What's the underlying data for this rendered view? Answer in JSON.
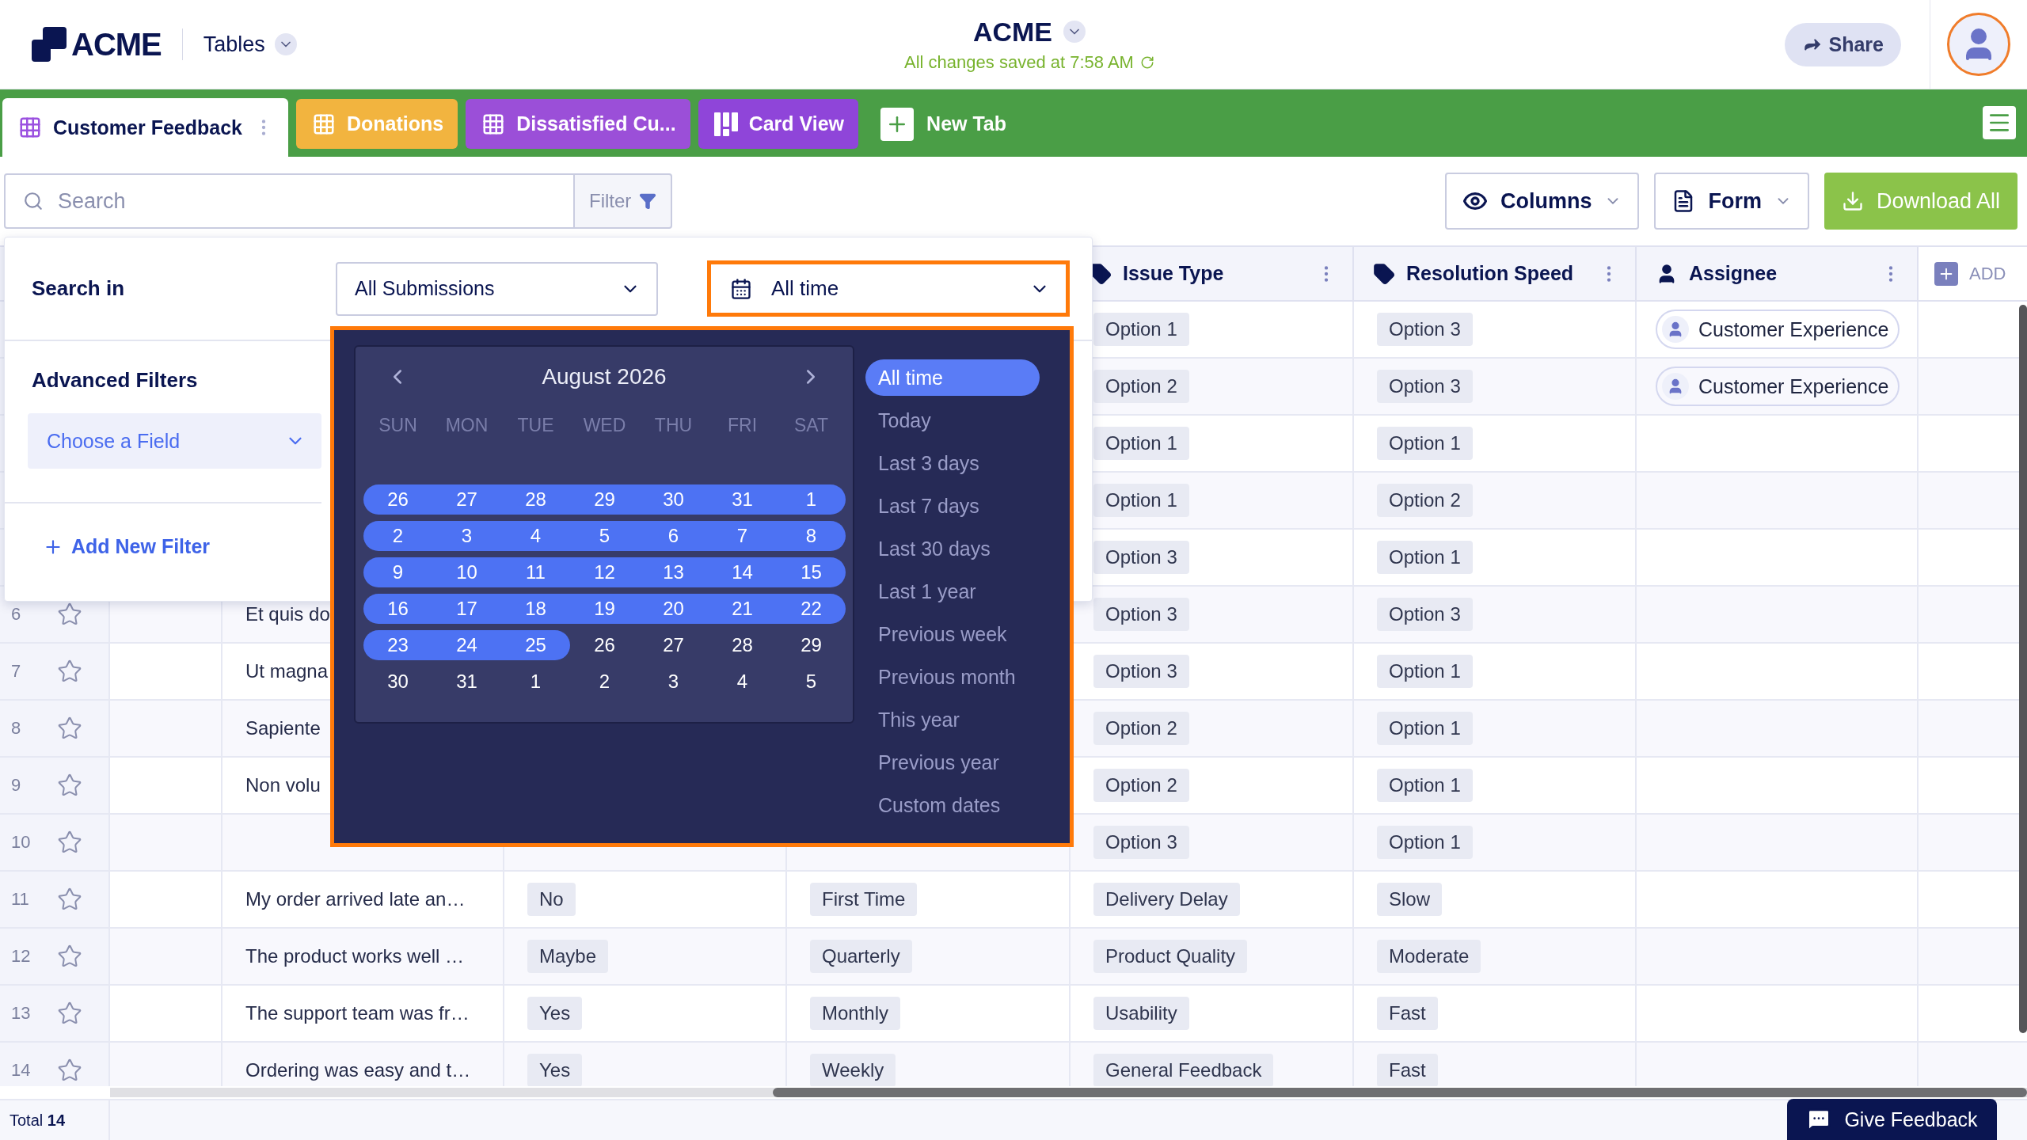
{
  "header": {
    "logo": "ACME",
    "section": "Tables",
    "title": "ACME",
    "saved_status": "All changes saved at 7:58 AM",
    "share": "Share"
  },
  "tabs": [
    {
      "label": "Customer Feedback",
      "kind": "table",
      "selected": true,
      "color": "#9b51e0"
    },
    {
      "label": "Donations",
      "kind": "table",
      "selected": false,
      "color": "#f2b43f"
    },
    {
      "label": "Dissatisfied Cu...",
      "kind": "table",
      "selected": false,
      "color": "#9b4fd8"
    },
    {
      "label": "Card View",
      "kind": "cards",
      "selected": false,
      "color": "#8f45d9"
    }
  ],
  "new_tab": "New Tab",
  "toolbar": {
    "search_placeholder": "Search",
    "filter": "Filter",
    "columns": "Columns",
    "form": "Form",
    "download": "Download All"
  },
  "table": {
    "columns": [
      {
        "label": "Issue Type",
        "kind": "tag"
      },
      {
        "label": "Resolution Speed",
        "kind": "tag"
      },
      {
        "label": "Assignee",
        "kind": "person"
      }
    ],
    "add_column": "ADD",
    "rows": [
      {
        "issue_type": "Option 1",
        "resolution_speed": "Option 3",
        "assignee": "Customer Experience"
      },
      {
        "issue_type": "Option 2",
        "resolution_speed": "Option 3",
        "assignee": "Customer Experience"
      },
      {
        "issue_type": "Option 1",
        "resolution_speed": "Option 1"
      },
      {
        "issue_type": "Option 1",
        "resolution_speed": "Option 2"
      },
      {
        "issue_type": "Option 3",
        "resolution_speed": "Option 1"
      },
      {
        "number": "6",
        "starred": false,
        "column_3": "Et quis do",
        "issue_type": "Option 3",
        "resolution_speed": "Option 3"
      },
      {
        "number": "7",
        "starred": false,
        "column_3": "Ut magna",
        "issue_type": "Option 3",
        "resolution_speed": "Option 1"
      },
      {
        "number": "8",
        "starred": false,
        "column_3": "Sapiente",
        "issue_type": "Option 2",
        "resolution_speed": "Option 1"
      },
      {
        "number": "9",
        "starred": false,
        "column_3": "Non volu",
        "issue_type": "Option 2",
        "resolution_speed": "Option 1"
      },
      {
        "number": "10",
        "starred": false,
        "issue_type": "Option 3",
        "resolution_speed": "Option 1"
      },
      {
        "number": "11",
        "starred": false,
        "column_3": "My order arrived late an…",
        "column_4": "No",
        "column_5": "First Time",
        "issue_type": "Delivery Delay",
        "resolution_speed": "Slow"
      },
      {
        "number": "12",
        "starred": false,
        "column_3": "The product works well …",
        "column_4": "Maybe",
        "column_5": "Quarterly",
        "issue_type": "Product Quality",
        "resolution_speed": "Moderate"
      },
      {
        "number": "13",
        "starred": false,
        "column_3": "The support team was fr…",
        "column_4": "Yes",
        "column_5": "Monthly",
        "issue_type": "Usability",
        "resolution_speed": "Fast"
      },
      {
        "number": "14",
        "starred": false,
        "column_3": "Ordering was easy and t…",
        "column_4": "Yes",
        "column_5": "Weekly",
        "issue_type": "General Feedback",
        "resolution_speed": "Fast"
      }
    ]
  },
  "footer": {
    "total": "Total **14**",
    "give_feedback": "Give Feedback"
  },
  "filter_panel": {
    "search_in": "Search in",
    "scope": "All Submissions",
    "range": "All time",
    "advanced_filters": "Advanced Filters",
    "field_placeholder": "Choose a Field",
    "add_filter": "Add New Filter"
  },
  "calendar": {
    "month": "August 2026",
    "weekdays": [
      "SUN",
      "MON",
      "TUE",
      "WED",
      "THU",
      "FRI",
      "SAT"
    ],
    "weeks": [
      [
        {
          "day": "26",
          "in_range": true
        },
        {
          "day": "27",
          "in_range": true
        },
        {
          "day": "28",
          "in_range": true
        },
        {
          "day": "29",
          "in_range": true
        },
        {
          "day": "30",
          "in_range": true
        },
        {
          "day": "31",
          "in_range": true
        },
        {
          "day": "1",
          "in_range": true
        }
      ],
      [
        {
          "day": "2",
          "in_range": true
        },
        {
          "day": "3",
          "in_range": true
        },
        {
          "day": "4",
          "in_range": true
        },
        {
          "day": "5",
          "in_range": true
        },
        {
          "day": "6",
          "in_range": true
        },
        {
          "day": "7",
          "in_range": true
        },
        {
          "day": "8",
          "in_range": true
        }
      ],
      [
        {
          "day": "9",
          "in_range": true
        },
        {
          "day": "10",
          "in_range": true
        },
        {
          "day": "11",
          "in_range": true
        },
        {
          "day": "12",
          "in_range": true
        },
        {
          "day": "13",
          "in_range": true
        },
        {
          "day": "14",
          "in_range": true
        },
        {
          "day": "15",
          "in_range": true
        }
      ],
      [
        {
          "day": "16",
          "in_range": true
        },
        {
          "day": "17",
          "in_range": true
        },
        {
          "day": "18",
          "in_range": true
        },
        {
          "day": "19",
          "in_range": true
        },
        {
          "day": "20",
          "in_range": true
        },
        {
          "day": "21",
          "in_range": true
        },
        {
          "day": "22",
          "in_range": true
        }
      ],
      [
        {
          "day": "23",
          "in_range": true
        },
        {
          "day": "24",
          "in_range": true
        },
        {
          "day": "25",
          "in_range": true
        },
        {
          "day": "26",
          "in_range": false
        },
        {
          "day": "27",
          "in_range": false
        },
        {
          "day": "28",
          "in_range": false
        },
        {
          "day": "29",
          "in_range": false
        }
      ],
      [
        {
          "day": "30",
          "in_range": false
        },
        {
          "day": "31",
          "in_range": false
        },
        {
          "day": "1",
          "in_range": false
        },
        {
          "day": "2",
          "in_range": false
        },
        {
          "day": "3",
          "in_range": false
        },
        {
          "day": "4",
          "in_range": false
        },
        {
          "day": "5",
          "in_range": false
        }
      ]
    ],
    "presets": [
      {
        "label": "All time",
        "selected": true
      },
      {
        "label": "Today",
        "selected": false
      },
      {
        "label": "Last 3 days",
        "selected": false
      },
      {
        "label": "Last 7 days",
        "selected": false
      },
      {
        "label": "Last 30 days",
        "selected": false
      },
      {
        "label": "Last 1 year",
        "selected": false
      },
      {
        "label": "Previous week",
        "selected": false
      },
      {
        "label": "Previous month",
        "selected": false
      },
      {
        "label": "This year",
        "selected": false
      },
      {
        "label": "Previous year",
        "selected": false
      },
      {
        "label": "Custom dates",
        "selected": false
      }
    ]
  }
}
